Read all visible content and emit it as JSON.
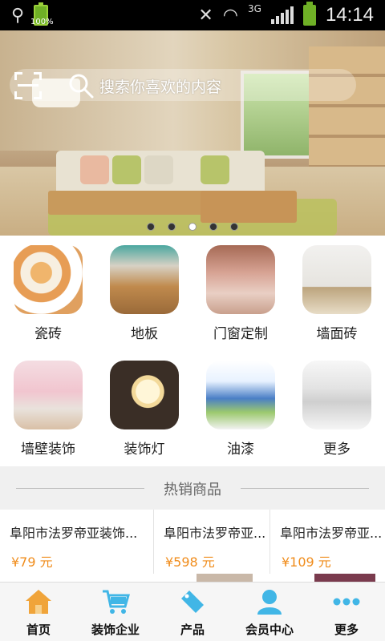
{
  "status_bar": {
    "battery_small_pct": "100%",
    "network": "3G",
    "time": "14:14"
  },
  "banner": {
    "search_placeholder": "搜索你喜欢的内容",
    "slide_count": 5,
    "active_slide": 3
  },
  "categories": [
    {
      "label": "瓷砖"
    },
    {
      "label": "地板"
    },
    {
      "label": "门窗定制"
    },
    {
      "label": "墙面砖"
    },
    {
      "label": "墙壁装饰"
    },
    {
      "label": "装饰灯"
    },
    {
      "label": "油漆"
    },
    {
      "label": "更多"
    }
  ],
  "hot": {
    "title": "热销商品",
    "products": [
      {
        "name": "阜阳市法罗帝亚装饰...",
        "price": "¥79 元"
      },
      {
        "name": "阜阳市法罗帝亚...",
        "price": "¥598 元"
      },
      {
        "name": "阜阳市法罗帝亚...",
        "price": "¥109 元"
      }
    ]
  },
  "bottom_nav": [
    {
      "label": "首页"
    },
    {
      "label": "装饰企业"
    },
    {
      "label": "产品"
    },
    {
      "label": "会员中心"
    },
    {
      "label": "更多"
    }
  ],
  "colors": {
    "accent": "#f08c1b",
    "nav_icon": "#41b6e6"
  }
}
